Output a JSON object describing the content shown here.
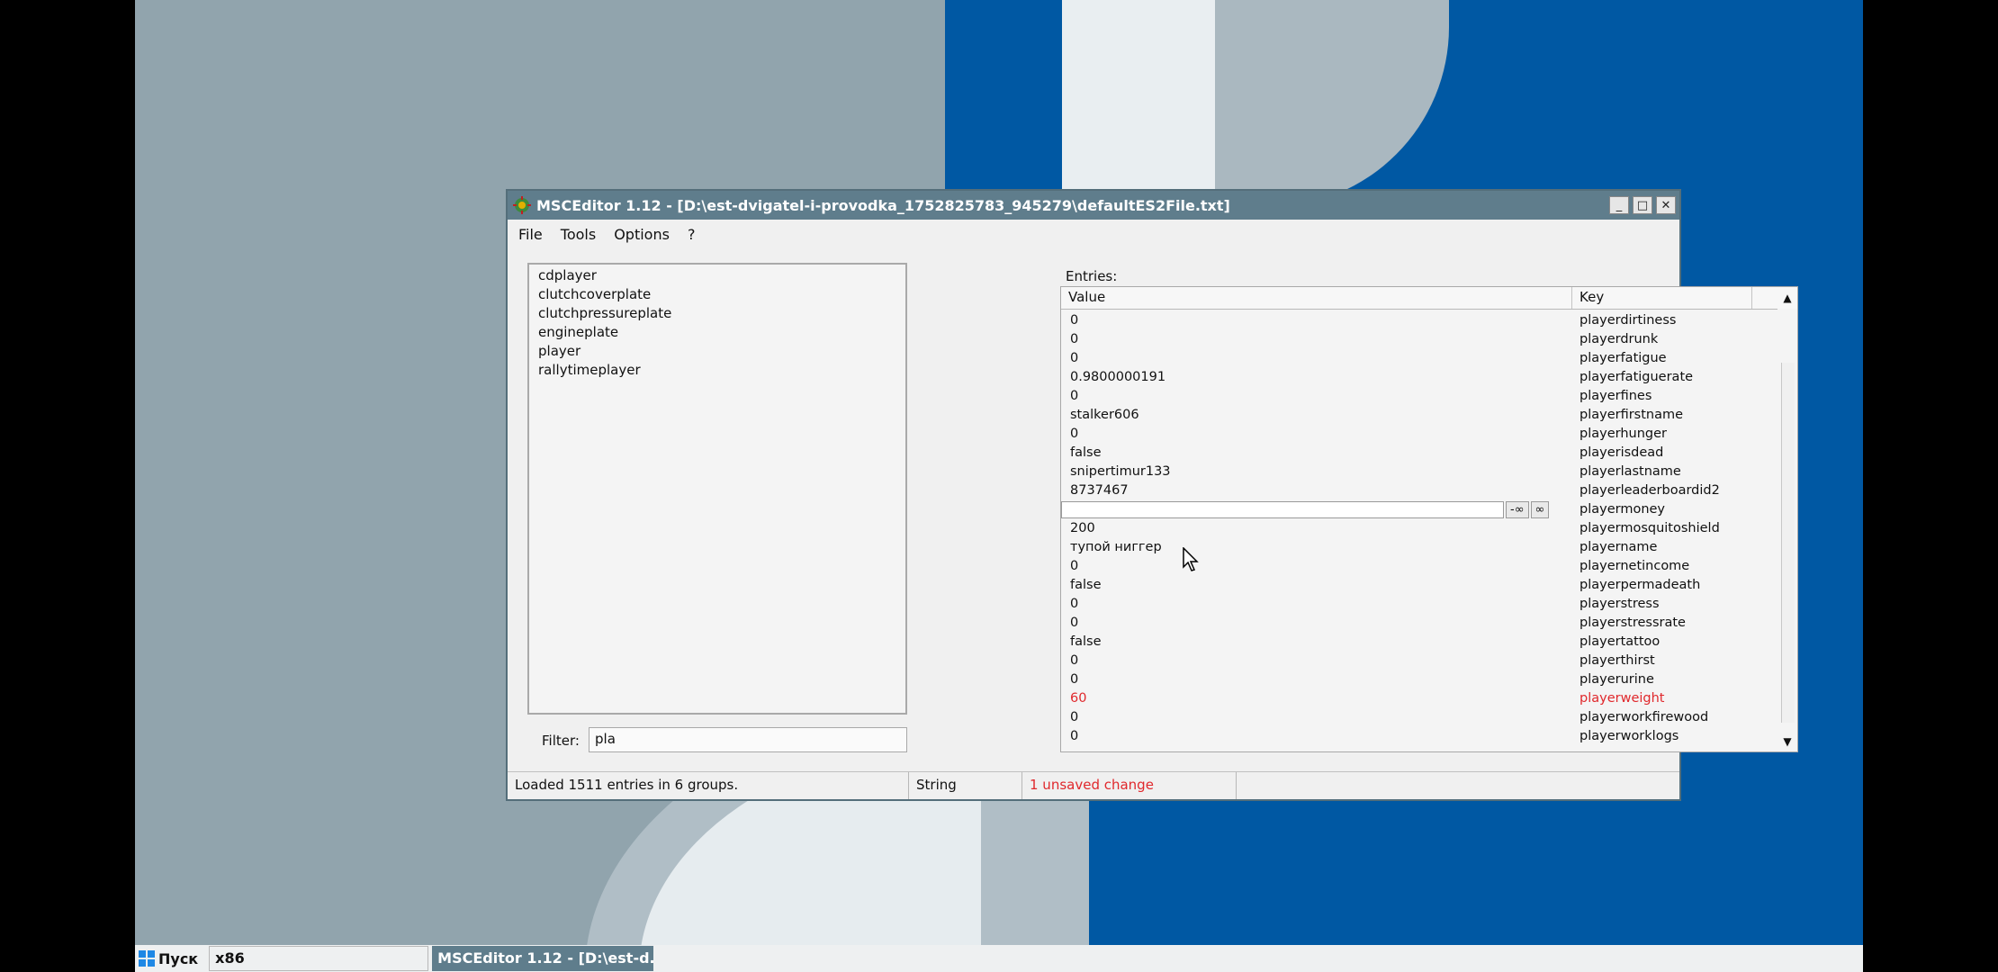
{
  "window": {
    "title": "MSCEditor 1.12 - [D:\\est-dvigatel-i-provodka_1752825783_945279\\defaultES2File.txt]",
    "controls": {
      "minimize": "_",
      "maximize": "□",
      "close": "✕"
    }
  },
  "menu": {
    "items": [
      "File",
      "Tools",
      "Options",
      "?"
    ]
  },
  "groups": [
    "cdplayer",
    "clutchcoverplate",
    "clutchpressureplate",
    "engineplate",
    "player",
    "rallytimeplayer"
  ],
  "filter": {
    "label": "Filter:",
    "value": "pla"
  },
  "entries": {
    "label": "Entries:",
    "headers": {
      "value": "Value",
      "key": "Key"
    },
    "rows": [
      {
        "value": "0",
        "key": "playerdirtiness"
      },
      {
        "value": "0",
        "key": "playerdrunk"
      },
      {
        "value": "0",
        "key": "playerfatigue"
      },
      {
        "value": "0.9800000191",
        "key": "playerfatiguerate"
      },
      {
        "value": "0",
        "key": "playerfines"
      },
      {
        "value": "stalker606",
        "key": "playerfirstname"
      },
      {
        "value": "0",
        "key": "playerhunger"
      },
      {
        "value": "false",
        "key": "playerisdead"
      },
      {
        "value": "snipertimur133",
        "key": "playerlastname"
      },
      {
        "value": "8737467",
        "key": "playerleaderboardid2"
      },
      {
        "value": "",
        "key": "playermoney",
        "editing": true
      },
      {
        "value": "200",
        "key": "playermosquitoshield"
      },
      {
        "value": "тупой ниггер",
        "key": "playername"
      },
      {
        "value": "0",
        "key": "playernetincome"
      },
      {
        "value": "false",
        "key": "playerpermadeath"
      },
      {
        "value": "0",
        "key": "playerstress"
      },
      {
        "value": "0",
        "key": "playerstressrate"
      },
      {
        "value": "false",
        "key": "playertattoo"
      },
      {
        "value": "0",
        "key": "playerthirst"
      },
      {
        "value": "0",
        "key": "playerurine"
      },
      {
        "value": "60",
        "key": "playerweight",
        "changed": true
      },
      {
        "value": "0",
        "key": "playerworkfirewood"
      },
      {
        "value": "0",
        "key": "playerworklogs"
      }
    ],
    "edit_buttons": {
      "neg_inf": "-∞",
      "pos_inf": "∞"
    }
  },
  "status": {
    "loaded": "Loaded 1511 entries in 6 groups.",
    "type": "String",
    "changes": "1 unsaved change",
    "extra": ""
  },
  "taskbar": {
    "start_label": "Пуск",
    "arch": "x86",
    "task": "MSCEditor 1.12 - [D:\\est-d..."
  },
  "colors": {
    "accent": "#5f7d8c",
    "changed": "#e0282c",
    "wallpaper_blue": "#0058a3"
  }
}
